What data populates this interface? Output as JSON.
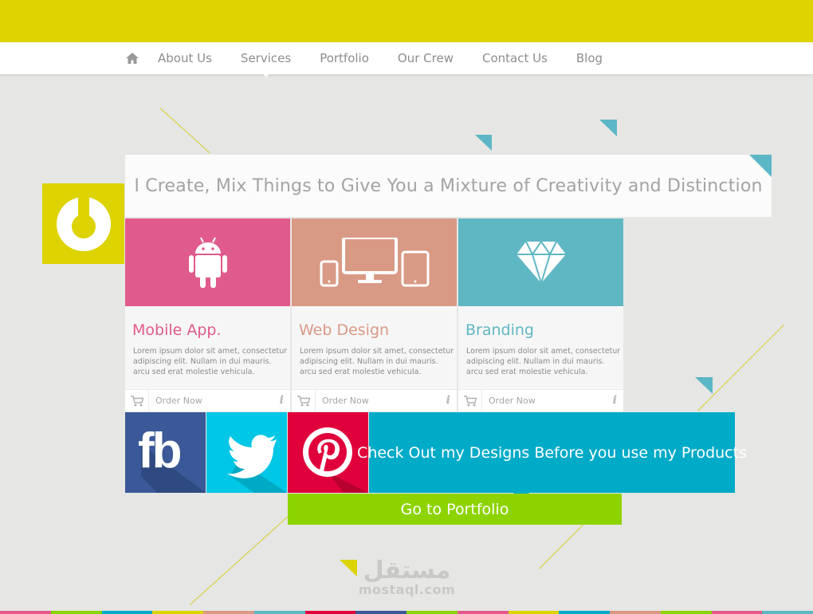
{
  "nav": {
    "items": [
      {
        "label": "About Us"
      },
      {
        "label": "Services"
      },
      {
        "label": "Portfolio"
      },
      {
        "label": "Our Crew"
      },
      {
        "label": "Contact Us"
      },
      {
        "label": "Blog"
      }
    ],
    "active_label": "Services"
  },
  "banner": {
    "text": "I Create,  Mix Things to Give You a Mixture of Creativity and Distinction"
  },
  "cards": [
    {
      "title": "Mobile App.",
      "desc": "Lorem ipsum dolor sit amet, consectetur adipiscing elit. Nullam in dui mauris. arcu sed erat molestie vehicula.",
      "order": "Order Now",
      "info": "i",
      "icon": "android-icon",
      "color": "#e05a8c"
    },
    {
      "title": "Web Design",
      "desc": "Lorem ipsum dolor sit amet, consectetur adipiscing elit. Nullam in dui mauris. arcu sed erat molestie vehicula.",
      "order": "Order Now",
      "info": "i",
      "icon": "devices-icon",
      "color": "#d99a85"
    },
    {
      "title": "Branding",
      "desc": "Lorem ipsum dolor sit amet, consectetur adipiscing elit. Nullam in dui mauris. arcu sed erat molestie vehicula.",
      "order": "Order Now",
      "info": "i",
      "icon": "diamond-icon",
      "color": "#5fb7c3"
    }
  ],
  "social": {
    "facebook": {
      "label": "fb",
      "color": "#3b5998"
    },
    "twitter": {
      "color": "#00c7e6"
    },
    "pinterest": {
      "color": "#e0003b"
    }
  },
  "cta": {
    "text": "Check Out my Designs Before you use my Products",
    "color": "#00abc8"
  },
  "portfolio_button": {
    "label": "Go to Portfolio",
    "color": "#8dd300"
  },
  "watermark": {
    "arabic": "مستقل",
    "latin": "mostaql.com"
  },
  "colors": {
    "accent_yellow": "#dcd300",
    "teal": "#5bb7c5"
  }
}
